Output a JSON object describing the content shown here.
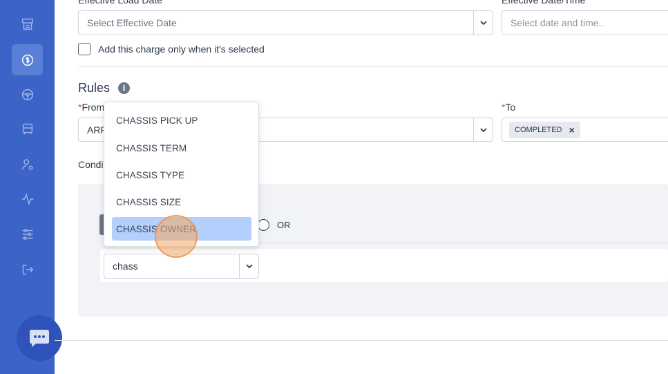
{
  "sidebar": {
    "items": [
      {
        "icon": "document-icon"
      },
      {
        "icon": "dollar-refresh-icon",
        "active": true
      },
      {
        "icon": "steering-wheel-icon"
      },
      {
        "icon": "truck-icon"
      },
      {
        "icon": "user-settings-icon"
      },
      {
        "icon": "activity-icon"
      },
      {
        "icon": "sliders-icon"
      },
      {
        "icon": "logout-icon"
      }
    ],
    "chat_icon": "chat-icon"
  },
  "form": {
    "effective_load_date_label": "Effective Load Date",
    "effective_load_date_placeholder": "Select Effective Date",
    "effective_date_time_label": "Effective Date/Time",
    "effective_date_time_placeholder": "Select date and time..",
    "checkbox_label": "Add this charge only when it's selected"
  },
  "rules": {
    "title": "Rules",
    "from_label": "From",
    "from_value_partial": "ARR",
    "to_label": "To",
    "to_tag": "COMPLETED",
    "conditions_label_partial": "Condi",
    "or_label": "OR",
    "search_input_value": "chass"
  },
  "dropdown": {
    "options": [
      "CHASSIS PICK UP",
      "CHASSIS TERM",
      "CHASSIS TYPE",
      "CHASSIS SIZE",
      "CHASSIS OWNER"
    ],
    "highlighted_index": 4
  },
  "colors": {
    "sidebar": "#3c63c7",
    "highlight": "#b3cffb",
    "required": "#d9534f"
  }
}
